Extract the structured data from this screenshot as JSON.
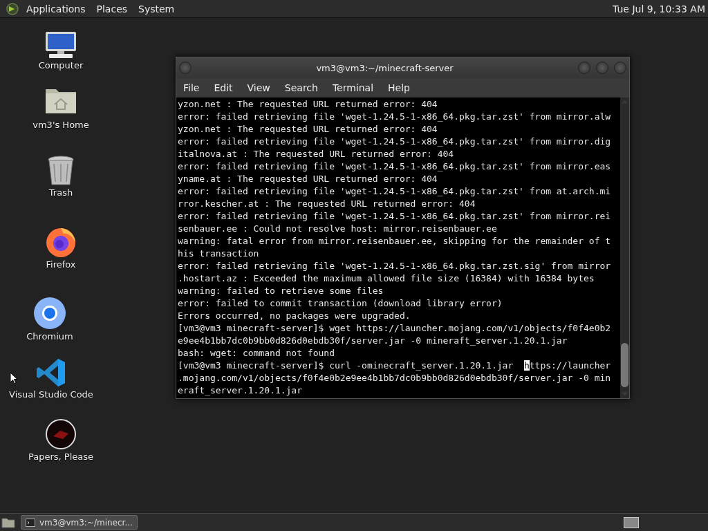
{
  "top_panel": {
    "menus": [
      "Applications",
      "Places",
      "System"
    ],
    "clock": "Tue Jul 9, 10:33 AM"
  },
  "desktop_icons": [
    {
      "kind": "computer",
      "label": "Computer"
    },
    {
      "kind": "home",
      "label": "vm3's Home"
    },
    {
      "kind": "trash",
      "label": "Trash"
    },
    {
      "kind": "firefox",
      "label": "Firefox"
    },
    {
      "kind": "chromium",
      "label": "Chromium"
    },
    {
      "kind": "vscode",
      "label": "Visual Studio Code"
    },
    {
      "kind": "game",
      "label": "Papers, Please"
    }
  ],
  "window": {
    "title": "vm3@vm3:~/minecraft-server",
    "menu": [
      "File",
      "Edit",
      "View",
      "Search",
      "Terminal",
      "Help"
    ],
    "terminal_lines": [
      {
        "kind": "plain",
        "text": "yzon.net : The requested URL returned error: 404"
      },
      {
        "kind": "plain",
        "text": "error: failed retrieving file 'wget-1.24.5-1-x86_64.pkg.tar.zst' from mirror.alw"
      },
      {
        "kind": "plain",
        "text": "yzon.net : The requested URL returned error: 404"
      },
      {
        "kind": "plain",
        "text": "error: failed retrieving file 'wget-1.24.5-1-x86_64.pkg.tar.zst' from mirror.dig"
      },
      {
        "kind": "plain",
        "text": "italnova.at : The requested URL returned error: 404"
      },
      {
        "kind": "plain",
        "text": "error: failed retrieving file 'wget-1.24.5-1-x86_64.pkg.tar.zst' from mirror.eas"
      },
      {
        "kind": "plain",
        "text": "yname.at : The requested URL returned error: 404"
      },
      {
        "kind": "plain",
        "text": "error: failed retrieving file 'wget-1.24.5-1-x86_64.pkg.tar.zst' from at.arch.mi"
      },
      {
        "kind": "plain",
        "text": "rror.kescher.at : The requested URL returned error: 404"
      },
      {
        "kind": "plain",
        "text": "error: failed retrieving file 'wget-1.24.5-1-x86_64.pkg.tar.zst' from mirror.rei"
      },
      {
        "kind": "plain",
        "text": "senbauer.ee : Could not resolve host: mirror.reisenbauer.ee"
      },
      {
        "kind": "plain",
        "text": "warning: fatal error from mirror.reisenbauer.ee, skipping for the remainder of t"
      },
      {
        "kind": "plain",
        "text": "his transaction"
      },
      {
        "kind": "plain",
        "text": "error: failed retrieving file 'wget-1.24.5-1-x86_64.pkg.tar.zst.sig' from mirror"
      },
      {
        "kind": "plain",
        "text": ".hostart.az : Exceeded the maximum allowed file size (16384) with 16384 bytes"
      },
      {
        "kind": "plain",
        "text": "warning: failed to retrieve some files"
      },
      {
        "kind": "plain",
        "text": "error: failed to commit transaction (download library error)"
      },
      {
        "kind": "plain",
        "text": "Errors occurred, no packages were upgraded."
      },
      {
        "kind": "plain",
        "text": "[vm3@vm3 minecraft-server]$ wget https://launcher.mojang.com/v1/objects/f0f4e0b2"
      },
      {
        "kind": "plain",
        "text": "e9ee4b1bb7dc0b9bb0d826d0ebdb30f/server.jar -0 mineraft_server.1.20.1.jar"
      },
      {
        "kind": "plain",
        "text": "bash: wget: command not found"
      },
      {
        "kind": "cursor",
        "before": "[vm3@vm3 minecraft-server]$ curl -ominecraft_server.1.20.1.jar  ",
        "cursor": "h",
        "after": "ttps://launcher"
      },
      {
        "kind": "plain",
        "text": ".mojang.com/v1/objects/f0f4e0b2e9ee4b1bb7dc0b9bb0d826d0ebdb30f/server.jar -0 min"
      },
      {
        "kind": "plain",
        "text": "eraft_server.1.20.1.jar"
      }
    ]
  },
  "taskbar": {
    "tasks": [
      {
        "label": "vm3@vm3:~/minecr...",
        "selected": true
      }
    ]
  }
}
